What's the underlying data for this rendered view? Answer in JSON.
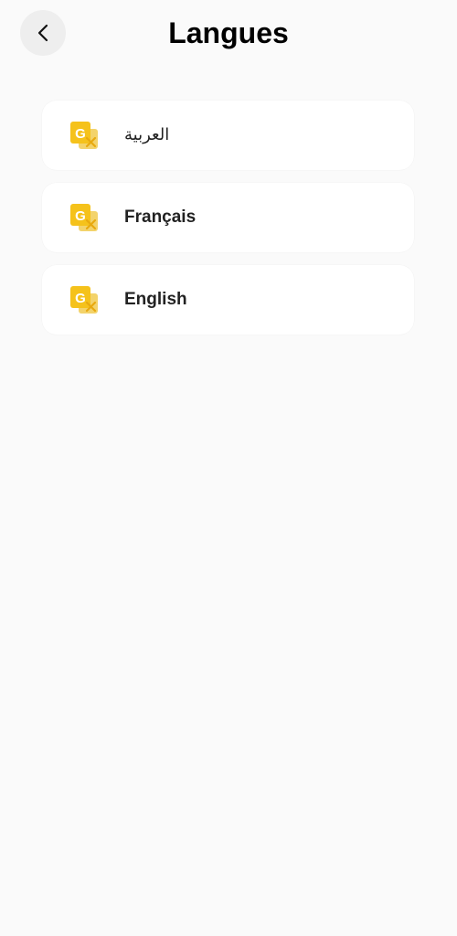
{
  "header": {
    "title": "Langues",
    "back_icon": "chevron-left-icon"
  },
  "languages": [
    {
      "label": "العربية",
      "icon": "translate-icon"
    },
    {
      "label": "Français",
      "icon": "translate-icon"
    },
    {
      "label": "English",
      "icon": "translate-icon"
    }
  ],
  "colors": {
    "background": "#fafafa",
    "card": "#ffffff",
    "icon_primary": "#f5c21b",
    "icon_secondary": "#e8a90f",
    "back_button_bg": "#eeeeee"
  }
}
